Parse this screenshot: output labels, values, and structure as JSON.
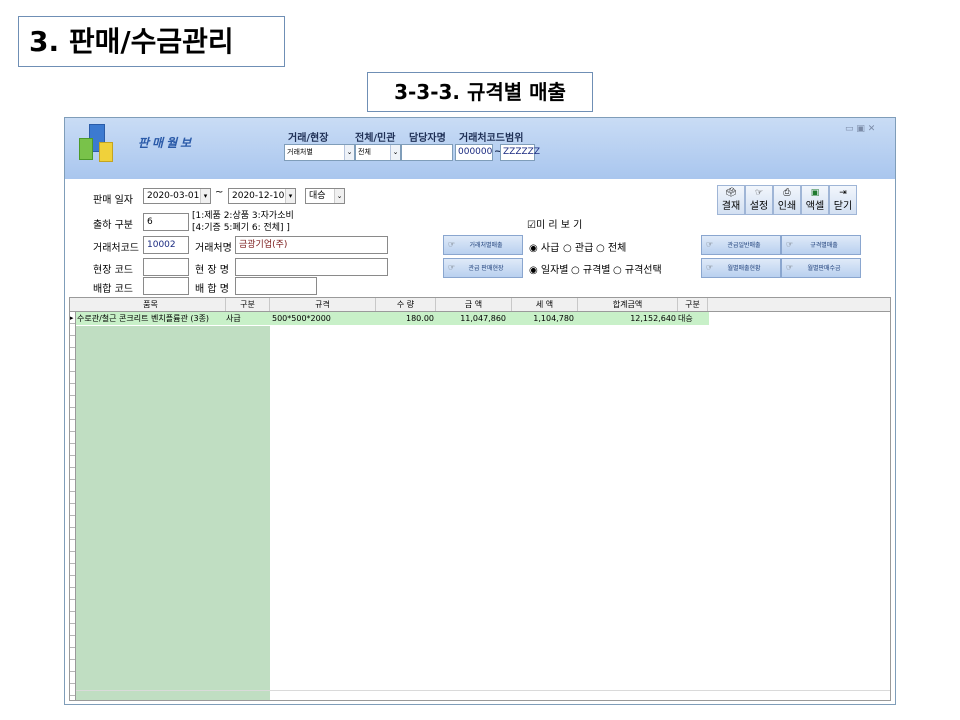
{
  "slide": {
    "title": "3. 판매/수금관리",
    "subtitle": "3-3-3. 규격별 매출"
  },
  "header": {
    "app_title": "판매월보",
    "labels": {
      "trade_site": "거래/현장",
      "entire": "전체/민관",
      "manager": "담당자명",
      "code_range": "거래처코드범위"
    },
    "combo_trade": "거래처별",
    "combo_entire": "전체",
    "code_from": "000000",
    "code_sep": "~",
    "code_to": "ZZZZZZ",
    "window_controls": "▭ ▣ ✕"
  },
  "filters": {
    "sale_date_label": "판매 일자",
    "date_from": "2020-03-01",
    "date_sep": "~",
    "date_to": "2020-12-10",
    "mode": "대승",
    "ship_type_label": "출하 구분",
    "ship_type_value": "6",
    "ship_hint_1": "[1:제품 2:상품 3:자가소비",
    "ship_hint_2": "[4:기증 5:폐기 6: 전체] ]",
    "client_code_label": "거래처코드",
    "client_code_value": "10002",
    "client_name_label": "거래처명",
    "client_name_value": "금광기업(주)",
    "site_code_label": "현장 코드",
    "site_name_label": "현 장 명",
    "mix_code_label": "배합 코드",
    "mix_name_label": "배 합 명"
  },
  "options": {
    "preview": "☑미 리 보 기",
    "radio1": [
      "◉ 사급",
      "○ 관급",
      "○ 전체"
    ],
    "radio2": [
      "◉ 일자별",
      "○ 규격별",
      "○ 규격선택"
    ]
  },
  "report_buttons": {
    "b1": "거래처별매출",
    "b2": "관급 판매현장",
    "b3": "관급일반매출",
    "b4": "규격별매출",
    "b5": "월별매출현황",
    "b6": "월별판매수금"
  },
  "toolbar": {
    "approve": "결재",
    "settings": "설정",
    "print": "인쇄",
    "excel": "액셀",
    "close": "닫기"
  },
  "grid": {
    "columns": [
      "품목",
      "구분",
      "규격",
      "수 량",
      "금 액",
      "세 액",
      "합계금액",
      "구분"
    ],
    "rows": [
      [
        "수로관/철근 콘크리트 벤치플륨관 (3종)",
        "사급",
        "500*500*2000",
        "180.00",
        "11,047,860",
        "1,104,780",
        "12,152,640",
        "대승"
      ]
    ]
  }
}
